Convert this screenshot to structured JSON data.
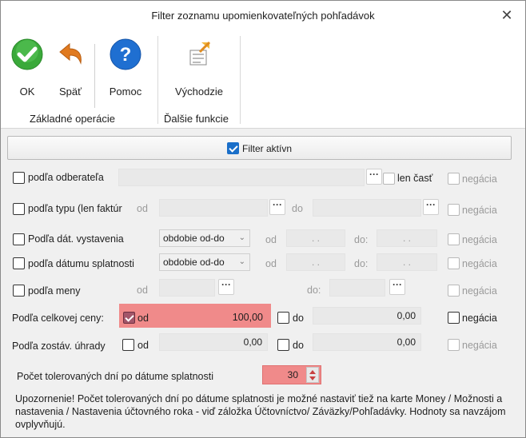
{
  "window": {
    "title": "Filter zoznamu upomienkovateľných pohľadávok"
  },
  "ribbon": {
    "ok": "OK",
    "back": "Späť",
    "help": "Pomoc",
    "defaults": "Východzie",
    "group_basic": "Základné operácie",
    "group_more": "Ďalšie funkcie"
  },
  "filter_active": {
    "label": "Filter aktívn",
    "checked": true
  },
  "rows": {
    "customer": {
      "label": "podľa odberateľa",
      "partial": "len časť",
      "negation": "negácia"
    },
    "type": {
      "label": "podľa typu (len faktúr",
      "from": "od",
      "to": "do",
      "negation": "negácia"
    },
    "issue_date": {
      "label": "Podľa dát. vystavenia",
      "select": "obdobie od-do",
      "from": "od",
      "to": "do:",
      "from_value": ". .",
      "to_value": ". .",
      "negation": "negácia"
    },
    "due_date": {
      "label": "podľa dátumu splatnosti",
      "select": "obdobie od-do",
      "from": "od",
      "to": "do:",
      "from_value": ". .",
      "to_value": ". .",
      "negation": "negácia"
    },
    "currency": {
      "label": "podľa meny",
      "from": "od",
      "to": "do:",
      "negation": "negácia"
    },
    "total_price": {
      "label": "Podľa celkovej ceny:",
      "from": "od",
      "from_value": "100,00",
      "to": "do",
      "to_value": "0,00",
      "negation": "negácia"
    },
    "remaining": {
      "label": "Podľa zostáv. úhrady",
      "from": "od",
      "from_value": "0,00",
      "to": "do",
      "to_value": "0,00",
      "negation": "negácia"
    }
  },
  "tolerance": {
    "label": "Počet tolerovaných dní po dátume splatnosti",
    "value": "30"
  },
  "note": "Upozornenie! Počet tolerovaných dní po dátume splatnosti je možné nastaviť tiež na karte Money / Možnosti a nastavenia / Nastavenia účtovného roka - viď záložka Účtovníctvo/ Záväzky/Pohľadávky. Hodnoty sa navzájom ovplyvňujú.",
  "colors": {
    "highlight": "#f08a8a",
    "ok_green": "#3aa93a",
    "help_blue": "#1f6fd1",
    "back_orange": "#e07a20",
    "checkbox_blue": "#1a6fc9"
  }
}
